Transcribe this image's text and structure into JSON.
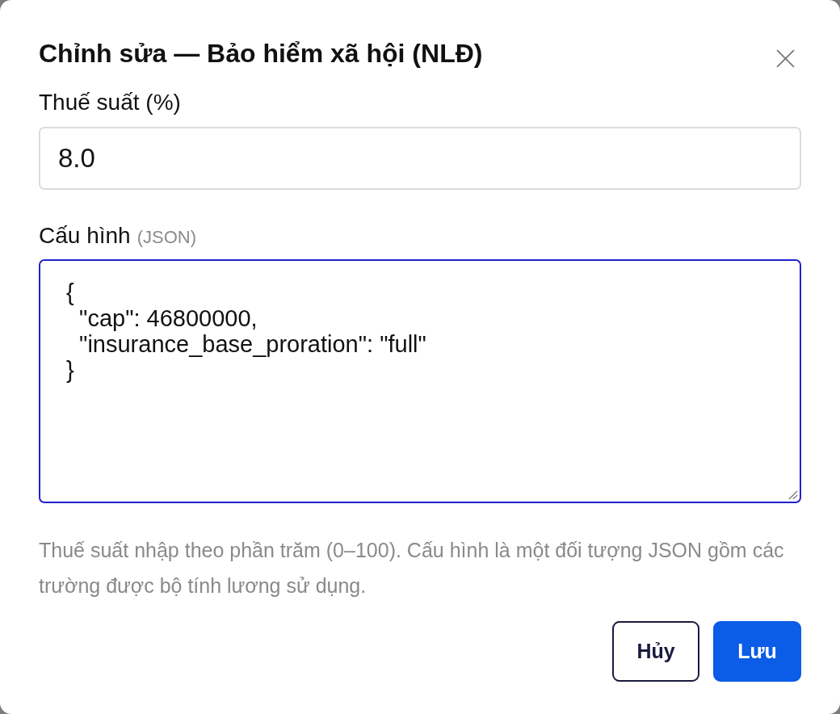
{
  "dialog": {
    "title": "Chỉnh sửa — Bảo hiểm xã hội (NLĐ)",
    "fields": [
      {
        "kind": "input",
        "label": "Thuế suất (%)",
        "value": "8.0",
        "focused": false
      },
      {
        "kind": "textarea",
        "label": "Cấu hình",
        "hint": "(JSON)",
        "value": "{\n  \"cap\": 46800000,\n  \"insurance_base_proration\": \"full\"\n}",
        "focused": true
      }
    ],
    "help_text": "Thuế suất nhập theo phần trăm (0–100). Cấu hình là một đối tượng JSON gồm các trường được bộ tính lương sử dụng.",
    "buttons": [
      {
        "label": "Hủy",
        "kind": "secondary"
      },
      {
        "label": "Lưu",
        "kind": "primary"
      }
    ]
  }
}
